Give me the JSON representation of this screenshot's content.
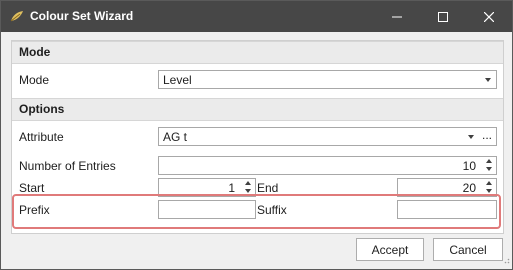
{
  "window": {
    "title": "Colour Set Wizard"
  },
  "mode_section": {
    "header": "Mode",
    "mode_label": "Mode",
    "mode_value": "Level"
  },
  "options_section": {
    "header": "Options",
    "attribute_label": "Attribute",
    "attribute_value": "AG t",
    "attribute_more": "...",
    "entries_label": "Number of Entries",
    "entries_value": "10",
    "start_label": "Start",
    "start_value": "1",
    "end_label": "End",
    "end_value": "20",
    "prefix_label": "Prefix",
    "prefix_value": "",
    "suffix_label": "Suffix",
    "suffix_value": ""
  },
  "buttons": {
    "accept": "Accept",
    "cancel": "Cancel"
  },
  "colors": {
    "titlebar": "#474747",
    "highlight": "#e07a7a"
  }
}
